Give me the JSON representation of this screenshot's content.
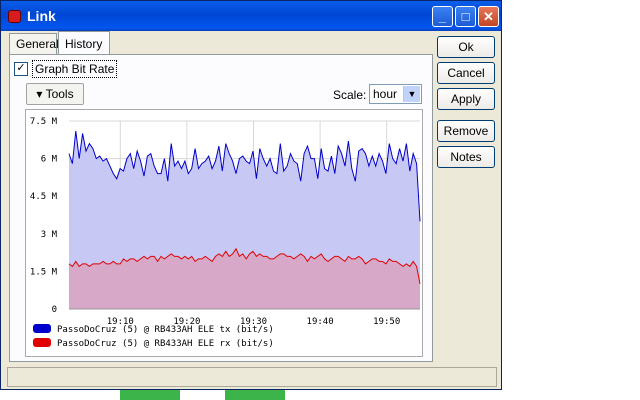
{
  "window": {
    "title": "Link"
  },
  "title_buttons": {
    "minimize": "_",
    "maximize": "□",
    "close": "✕"
  },
  "tabs": [
    {
      "label": "General"
    },
    {
      "label": "History"
    }
  ],
  "checkbox": {
    "label": "Graph Bit Rate",
    "checked": true,
    "mark": "✓"
  },
  "toolbar": {
    "tools_label": "▾ Tools",
    "scale_label": "Scale:",
    "scale_value": "hour",
    "scale_arrow": "▼"
  },
  "side_buttons": {
    "ok": "Ok",
    "cancel": "Cancel",
    "apply": "Apply",
    "remove": "Remove",
    "notes": "Notes"
  },
  "colors": {
    "tx": "#0000cc",
    "rx": "#e00000",
    "tx_fill": "#c8c8f4",
    "rx_fill": "#d8a8c8"
  },
  "chart_data": {
    "type": "area",
    "yticks": [
      "7.5 M",
      "6 M",
      "4.5 M",
      "3 M",
      "1.5 M",
      "0"
    ],
    "ylim": [
      0,
      7.5
    ],
    "xticks": [
      "19:10",
      "19:20",
      "19:30",
      "19:40",
      "19:50"
    ],
    "grid": true,
    "legend_position": "bottom-left",
    "series": [
      {
        "name": "PassoDoCruz (5) @ RB433AH ELE tx (bit/s)",
        "values": [
          6.2,
          5.8,
          7.1,
          6.0,
          7.0,
          6.3,
          6.6,
          6.4,
          6.0,
          6.1,
          5.9,
          6.0,
          5.7,
          5.4,
          5.2,
          5.6,
          5.5,
          6.0,
          6.2,
          5.6,
          6.3,
          5.9,
          5.3,
          6.1,
          6.2,
          5.7,
          5.4,
          5.4,
          6.0,
          5.1,
          6.6,
          5.7,
          5.9,
          5.6,
          5.9,
          5.4,
          5.6,
          6.4,
          5.6,
          5.8,
          5.9,
          6.1,
          5.6,
          5.9,
          6.5,
          5.5,
          6.6,
          6.2,
          5.9,
          5.4,
          6.0,
          6.1,
          5.9,
          5.8,
          6.3,
          5.2,
          6.4,
          6.0,
          5.7,
          6.0,
          5.5,
          5.4,
          6.6,
          5.5,
          5.7,
          6.2,
          5.9,
          5.8,
          5.1,
          6.2,
          6.5,
          6.0,
          6.0,
          5.2,
          6.4,
          5.6,
          5.5,
          6.1,
          5.4,
          6.5,
          6.2,
          5.7,
          6.7,
          5.6,
          5.1,
          6.3,
          6.4,
          6.2,
          5.7,
          6.1,
          5.7,
          6.2,
          5.9,
          5.4,
          6.6,
          6.0,
          5.8,
          6.4,
          5.9,
          6.6,
          5.5,
          6.2,
          5.8,
          3.5
        ],
        "color": "#0000cc"
      },
      {
        "name": "PassoDoCruz (5) @ RB433AH ELE rx (bit/s)",
        "values": [
          1.8,
          1.7,
          1.9,
          1.7,
          1.8,
          1.8,
          1.7,
          1.8,
          1.8,
          1.8,
          1.9,
          1.8,
          1.8,
          1.9,
          1.8,
          1.8,
          2.0,
          1.9,
          2.0,
          2.0,
          1.9,
          2.0,
          2.1,
          2.0,
          2.1,
          2.1,
          1.9,
          2.1,
          2.0,
          2.1,
          2.2,
          2.1,
          2.1,
          2.0,
          2.1,
          2.0,
          2.1,
          1.9,
          2.0,
          2.0,
          2.1,
          2.0,
          1.9,
          2.1,
          2.2,
          2.1,
          2.3,
          2.1,
          2.2,
          2.4,
          2.1,
          2.2,
          2.0,
          2.2,
          2.3,
          2.1,
          2.2,
          2.1,
          2.1,
          2.0,
          2.0,
          2.1,
          2.2,
          2.2,
          2.1,
          2.1,
          2.0,
          2.1,
          2.2,
          2.1,
          1.9,
          2.1,
          2.0,
          2.1,
          2.2,
          2.0,
          1.9,
          2.0,
          2.1,
          2.1,
          2.0,
          1.9,
          2.1,
          2.0,
          2.0,
          2.1,
          2.0,
          1.8,
          1.9,
          2.0,
          2.0,
          1.9,
          1.9,
          1.8,
          2.0,
          1.9,
          1.9,
          1.8,
          1.7,
          1.8,
          1.7,
          1.9,
          1.7,
          1.0
        ],
        "color": "#e00000"
      }
    ]
  }
}
